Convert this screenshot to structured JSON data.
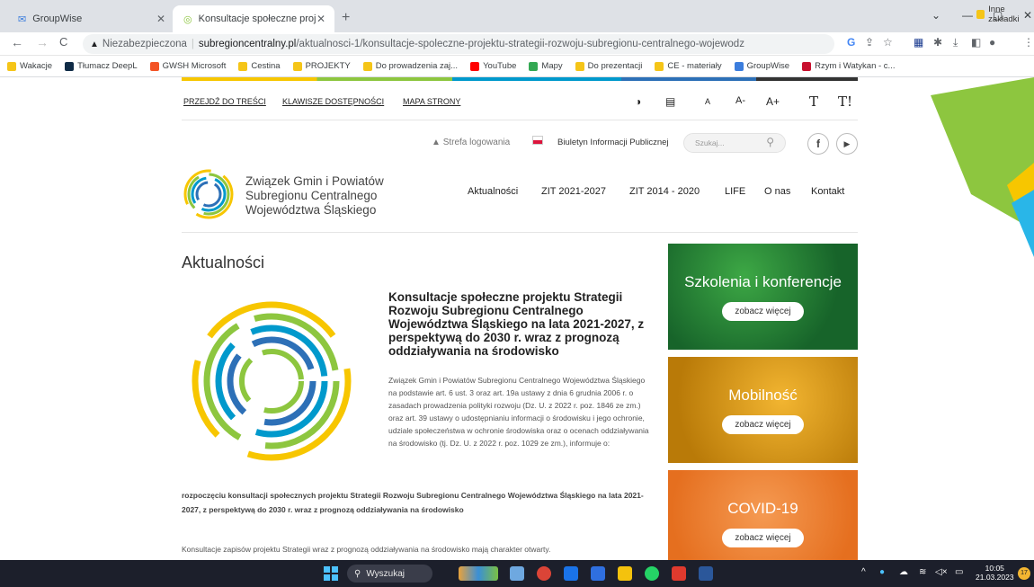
{
  "browser": {
    "tabs": [
      {
        "label": "GroupWise",
        "active": false
      },
      {
        "label": "Konsultacje społeczne projektu S",
        "active": true
      }
    ],
    "new_tab": "+",
    "window_controls": [
      "⌄",
      "—",
      "▢",
      "✕"
    ],
    "nav": {
      "back": "←",
      "forward": "→",
      "reload": "C"
    },
    "address": {
      "security": "Niezabezpieczona",
      "host": "subregioncentralny.pl",
      "path": "/aktualnosci-1/konsultacje-spoleczne-projektu-strategii-rozwoju-subregionu-centralnego-wojewodz"
    },
    "bookmarks": [
      {
        "label": "Wakacje",
        "color": "#f5c518"
      },
      {
        "label": "Tłumacz DeepL",
        "color": "#0f2b46"
      },
      {
        "label": "GWSH Microsoft",
        "color": "#f35325"
      },
      {
        "label": "Cestina",
        "color": "#f5c518"
      },
      {
        "label": "PROJEKTY",
        "color": "#f5c518"
      },
      {
        "label": "Do prowadzenia zaj...",
        "color": "#f5c518"
      },
      {
        "label": "YouTube",
        "color": "#ff0000"
      },
      {
        "label": "Mapy",
        "color": "#34a853"
      },
      {
        "label": "Do prezentacji",
        "color": "#f5c518"
      },
      {
        "label": "CE - materiały",
        "color": "#f5c518"
      },
      {
        "label": "GroupWise",
        "color": "#3b7ddd"
      },
      {
        "label": "Rzym i Watykan - c...",
        "color": "#c8102e"
      }
    ],
    "other_bookmarks": "Inne zakładki"
  },
  "site": {
    "access_links": [
      "PRZEJDŹ DO TREŚCI",
      "KLAWISZE DOSTĘPNOŚCI",
      "MAPA STRONY"
    ],
    "access_icons": [
      "◑",
      "▤",
      "A",
      "A-",
      "A+",
      "T",
      "T!"
    ],
    "login": "Strefa logowania",
    "bip": "Biuletyn Informacji Publicznej",
    "search_placeholder": "Szukaj...",
    "logo_lines": [
      "Związek Gmin i Powiatów",
      "Subregionu Centralnego",
      "Województwa Śląskiego"
    ],
    "nav": [
      "Aktualności",
      "ZIT 2021-2027",
      "ZIT 2014 - 2020",
      "LIFE",
      "O nas",
      "Kontakt"
    ],
    "section_title": "Aktualności",
    "article": {
      "title": "Konsultacje społeczne projektu Strategii Rozwoju Subregionu Centralnego Województwa Śląskiego na lata 2021-2027, z perspektywą do 2030 r. wraz z prognozą oddziaływania na środowisko",
      "body": "Związek Gmin i Powiatów Subregionu Centralnego Województwa Śląskiego na podstawie art. 6 ust. 3 oraz art. 19a ustawy z dnia 6 grudnia 2006 r. o zasadach prowadzenia polityki rozwoju (Dz. U. z 2022 r. poz. 1846 ze zm.) oraz art. 39 ustawy o udostępnianiu informacji o środowisku i jego ochronie, udziale społeczeństwa w ochronie środowiska oraz o ocenach oddziaływania na środowisko (tj. Dz. U. z 2022 r. poz. 1029 ze zm.), informuje o:",
      "lead": "rozpoczęciu konsultacji społecznych projektu Strategii Rozwoju Subregionu Centralnego Województwa Śląskiego na lata 2021-2027, z perspektywą do 2030 r. wraz z prognozą oddziaływania na środowisko",
      "last": "Konsultacje zapisów projektu Strategii wraz z prognozą oddziaływania na środowisko mają charakter otwarty."
    },
    "promos": [
      {
        "title": "Szkolenia i konferencje",
        "button": "zobacz więcej",
        "color": "#1f7a2e"
      },
      {
        "title": "Mobilność",
        "button": "zobacz więcej",
        "color": "#d99a12"
      },
      {
        "title": "COVID-19",
        "button": "zobacz więcej",
        "color": "#ef7d2b"
      }
    ]
  },
  "taskbar": {
    "search": "Wyszukaj",
    "time": "10:05",
    "date": "21.03.2023",
    "badge": "17"
  }
}
